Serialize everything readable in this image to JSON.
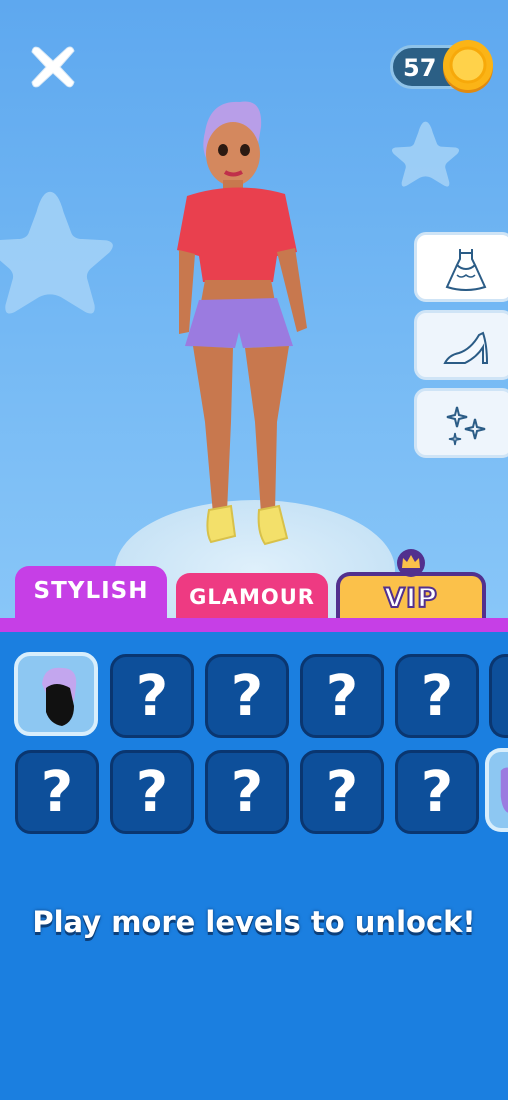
{
  "header": {
    "close_icon": "close-icon",
    "coins": "57",
    "coin_icon": "coin-icon"
  },
  "side_menu": [
    {
      "name": "dress-icon",
      "active": true
    },
    {
      "name": "high-heel-icon",
      "active": false
    },
    {
      "name": "sparkle-icon",
      "active": false
    }
  ],
  "tabs": {
    "stylish": "STYLISH",
    "glamour": "GLAMOUR",
    "vip": "VIP"
  },
  "items": {
    "row1": [
      {
        "type": "owned",
        "icon": "hairstyle-icon"
      },
      {
        "type": "locked",
        "label": "?"
      },
      {
        "type": "locked",
        "label": "?"
      },
      {
        "type": "locked",
        "label": "?"
      },
      {
        "type": "locked",
        "label": "?"
      }
    ],
    "row2": [
      {
        "type": "locked",
        "label": "?"
      },
      {
        "type": "locked",
        "label": "?"
      },
      {
        "type": "locked",
        "label": "?"
      },
      {
        "type": "locked",
        "label": "?"
      },
      {
        "type": "locked",
        "label": "?"
      }
    ]
  },
  "message": "Play more levels to unlock!",
  "colors": {
    "stylish_tab": "#c63fe6",
    "glamour_tab": "#ee3a82",
    "vip_tab": "#fbc14a",
    "panel": "#1b7fe0",
    "tile": "#0d4f9a"
  }
}
